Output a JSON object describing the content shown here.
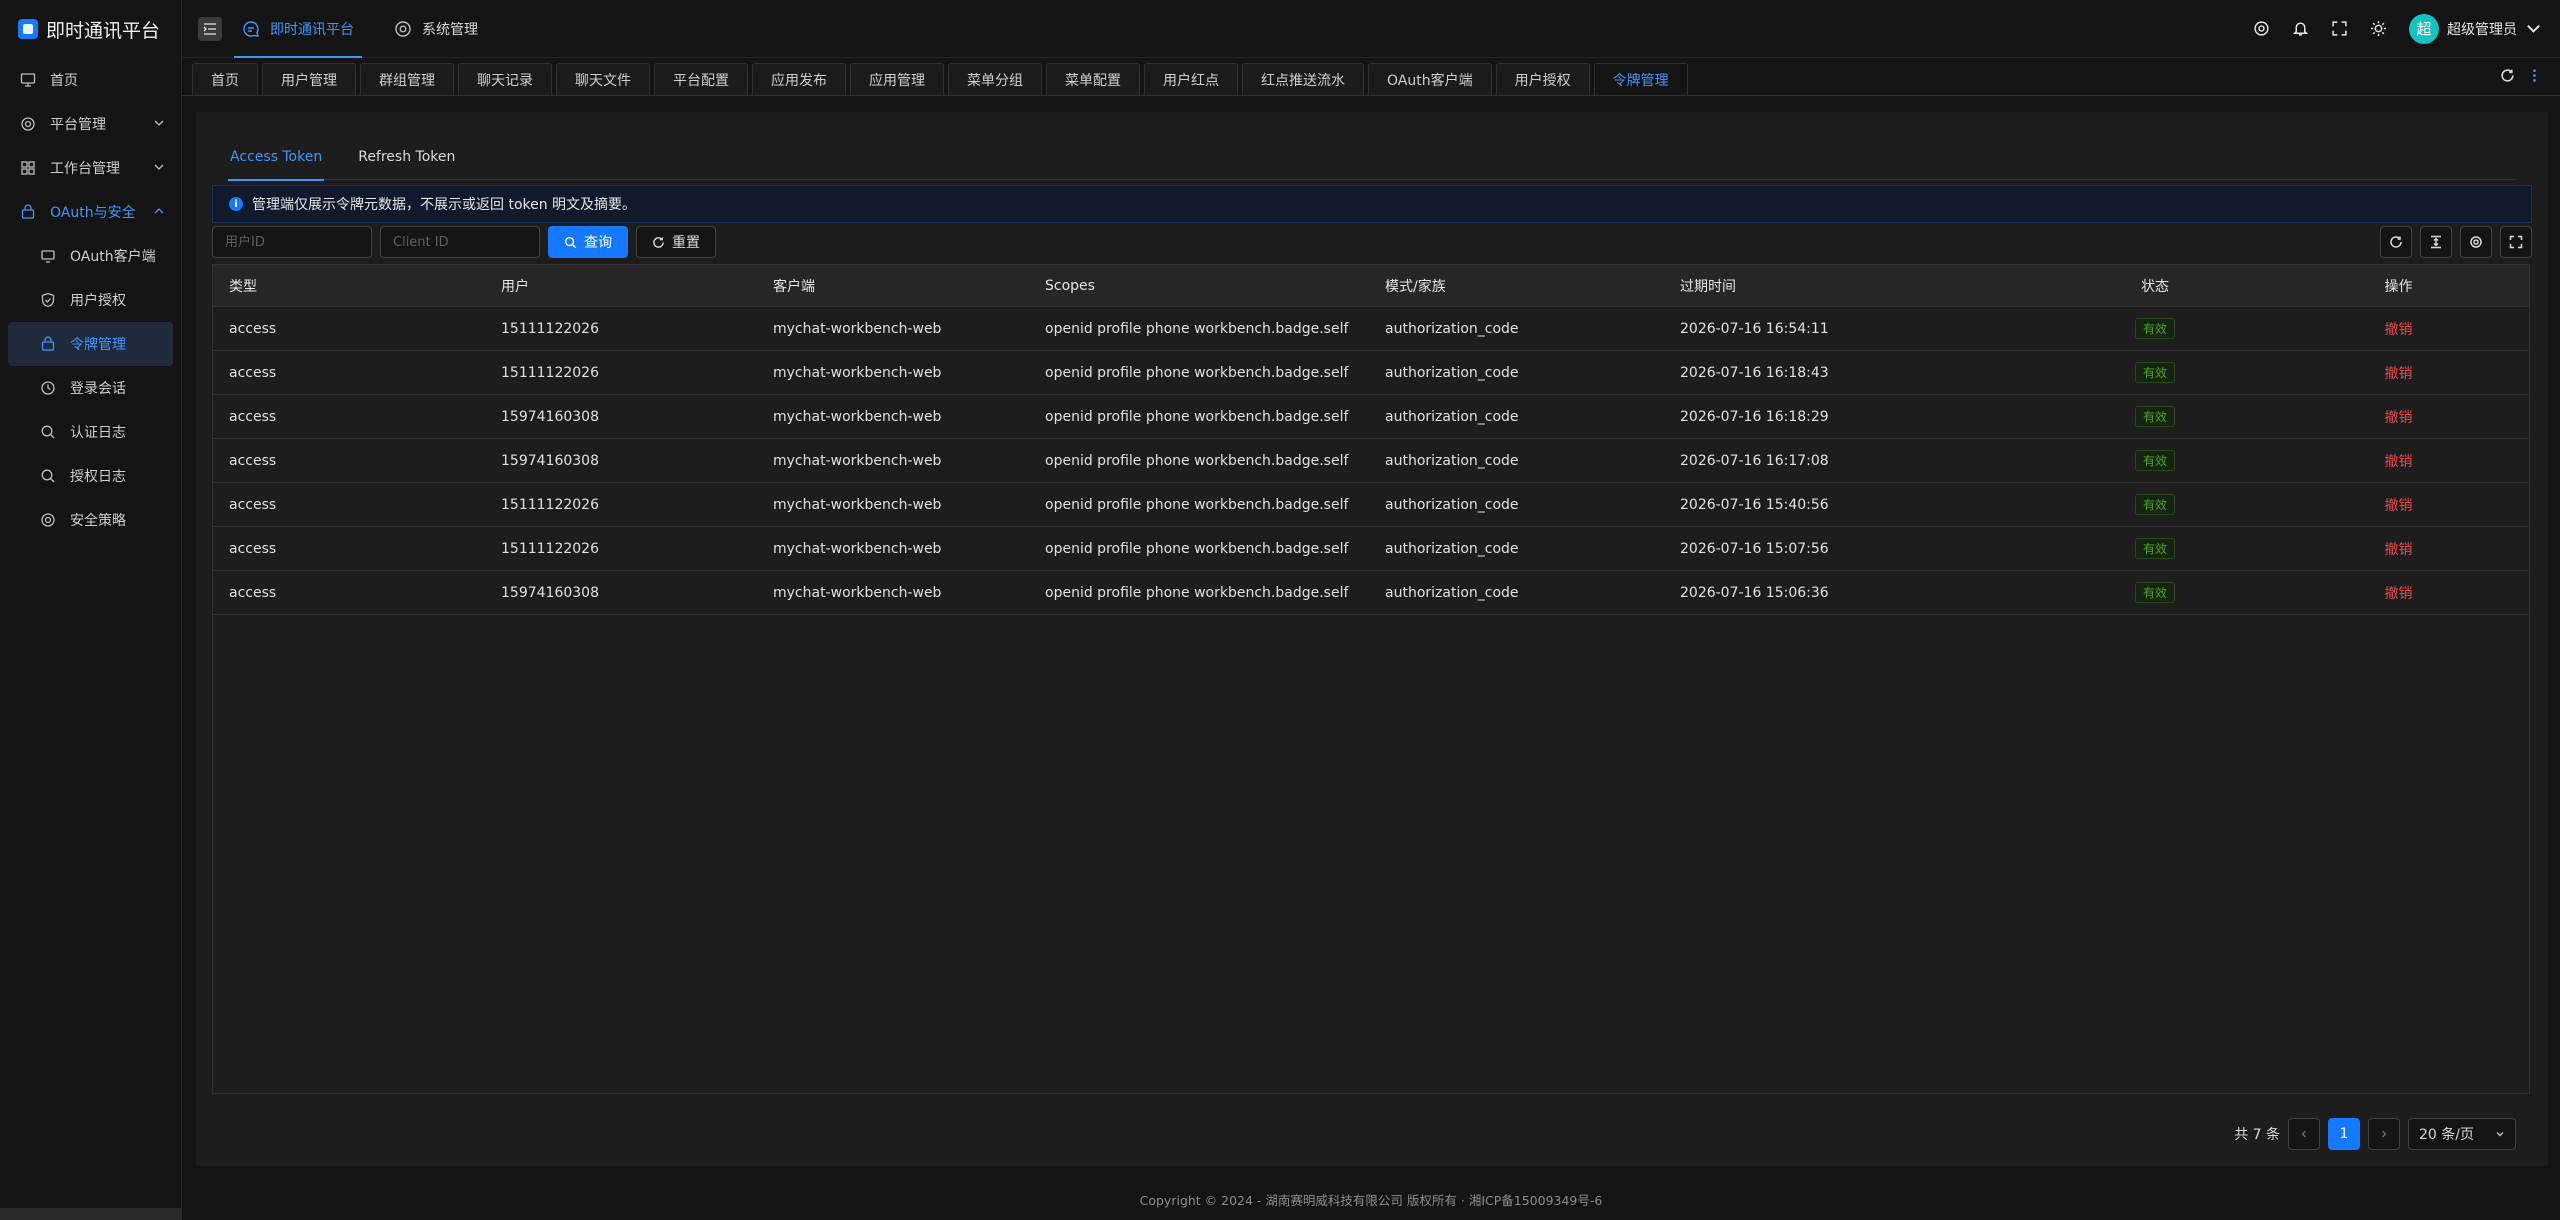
{
  "app": {
    "title": "即时通讯平台"
  },
  "sidebar": {
    "home": "首页",
    "platform": "平台管理",
    "workbench": "工作台管理",
    "security": "OAuth与安全",
    "sub": [
      "OAuth客户端",
      "用户授权",
      "令牌管理",
      "登录会话",
      "认证日志",
      "授权日志",
      "安全策略"
    ]
  },
  "header": {
    "nav1": "即时通讯平台",
    "nav2": "系统管理",
    "user": "超级管理员",
    "avatar": "超"
  },
  "tabs": [
    "首页",
    "用户管理",
    "群组管理",
    "聊天记录",
    "聊天文件",
    "平台配置",
    "应用发布",
    "应用管理",
    "菜单分组",
    "菜单配置",
    "用户红点",
    "红点推送流水",
    "OAuth客户端",
    "用户授权",
    "令牌管理"
  ],
  "subtabs": [
    "Access Token",
    "Refresh Token"
  ],
  "alert": "管理端仅展示令牌元数据，不展示或返回 token 明文及摘要。",
  "filters": {
    "user_placeholder": "用户ID",
    "client_placeholder": "Client ID",
    "query": "查询",
    "reset": "重置"
  },
  "table": {
    "headers": [
      "类型",
      "用户",
      "客户端",
      "Scopes",
      "模式/家族",
      "过期时间",
      "状态",
      "操作"
    ],
    "rows": [
      [
        "access",
        "15111122026",
        "mychat-workbench-web",
        "openid profile phone workbench.badge.self",
        "authorization_code",
        "2026-07-16 16:54:11",
        "有效",
        "撤销"
      ],
      [
        "access",
        "15111122026",
        "mychat-workbench-web",
        "openid profile phone workbench.badge.self",
        "authorization_code",
        "2026-07-16 16:18:43",
        "有效",
        "撤销"
      ],
      [
        "access",
        "15974160308",
        "mychat-workbench-web",
        "openid profile phone workbench.badge.self",
        "authorization_code",
        "2026-07-16 16:18:29",
        "有效",
        "撤销"
      ],
      [
        "access",
        "15974160308",
        "mychat-workbench-web",
        "openid profile phone workbench.badge.self",
        "authorization_code",
        "2026-07-16 16:17:08",
        "有效",
        "撤销"
      ],
      [
        "access",
        "15111122026",
        "mychat-workbench-web",
        "openid profile phone workbench.badge.self",
        "authorization_code",
        "2026-07-16 15:40:56",
        "有效",
        "撤销"
      ],
      [
        "access",
        "15111122026",
        "mychat-workbench-web",
        "openid profile phone workbench.badge.self",
        "authorization_code",
        "2026-07-16 15:07:56",
        "有效",
        "撤销"
      ],
      [
        "access",
        "15974160308",
        "mychat-workbench-web",
        "openid profile phone workbench.badge.self",
        "authorization_code",
        "2026-07-16 15:06:36",
        "有效",
        "撤销"
      ]
    ]
  },
  "pager": {
    "total": "共 7 条",
    "page": "1",
    "size": "20 条/页"
  },
  "footer": "Copyright © 2024 - 湖南赛明威科技有限公司 版权所有 · 湘ICP备15009349号-6"
}
